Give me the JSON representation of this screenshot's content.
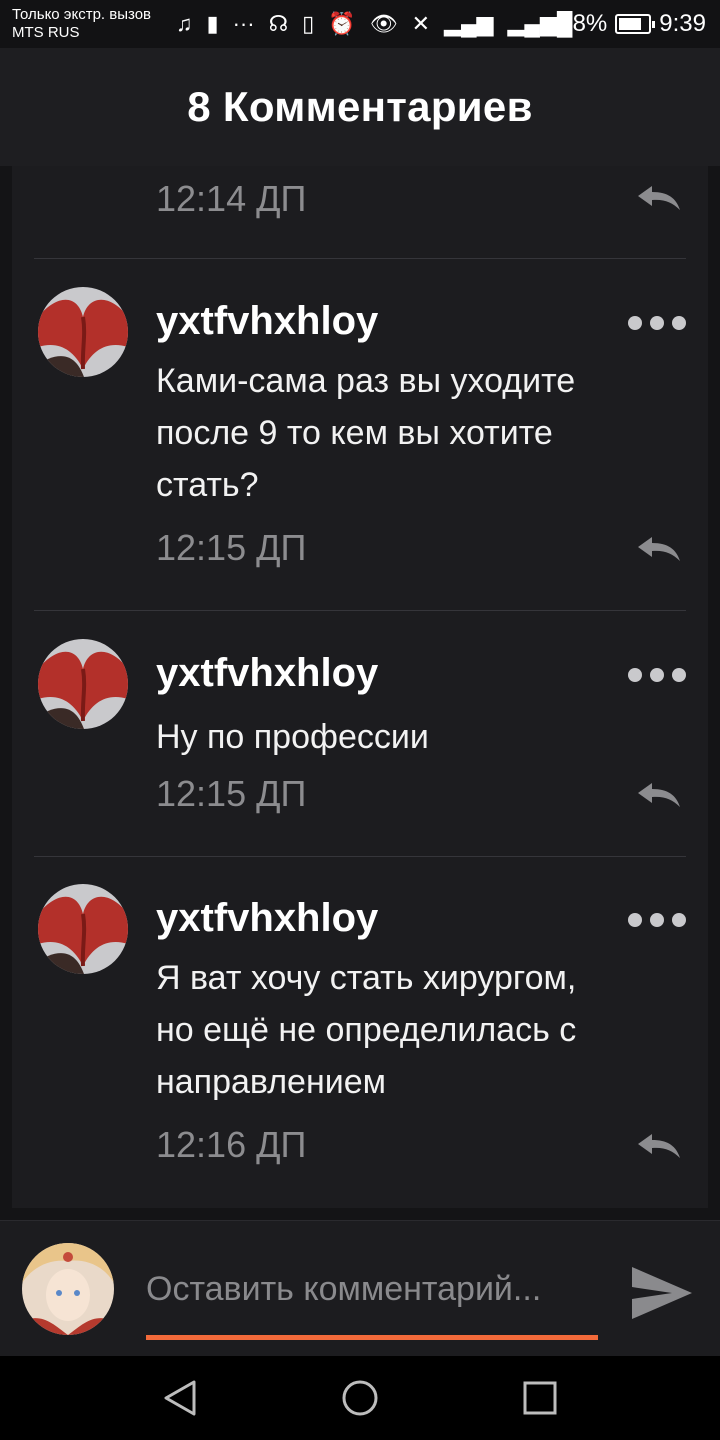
{
  "status_bar": {
    "carrier_line1": "Только экстр. вызов",
    "carrier_line2": "MTS RUS",
    "icons": [
      "music-note-icon",
      "sd-card-icon",
      "more-dots-icon",
      "headset-icon",
      "vibrate-icon",
      "alarm-icon",
      "eye-icon",
      "phone-missed-icon",
      "signal-off-icon",
      "4g-signal-icon"
    ],
    "battery_percent": "78%",
    "battery_level": 0.78,
    "time": "9:39"
  },
  "header": {
    "title": "8 Комментариев"
  },
  "comments": [
    {
      "time": "12:14 ДП",
      "partial": true
    },
    {
      "author": "yxtfvhxhloy",
      "lines": [
        "Ками-сама раз вы уходите",
        "после 9 то кем вы хотите",
        "стать?"
      ],
      "time": "12:15 ДП"
    },
    {
      "author": "yxtfvhxhloy",
      "lines": [
        "Ну по профессии"
      ],
      "time": "12:15 ДП"
    },
    {
      "author": "yxtfvhxhloy",
      "lines": [
        "Я ват хочу стать хирургом,",
        "но ещё не определилась с",
        "направлением"
      ],
      "time": "12:16 ДП"
    }
  ],
  "composer": {
    "placeholder": "Оставить комментарий...",
    "underline_color": "#f26a3a"
  },
  "colors": {
    "background": "#141416",
    "card": "#1c1c1f",
    "header": "#1e1e21",
    "accent": "#f26a3a",
    "muted_text": "#8c8c8f"
  }
}
